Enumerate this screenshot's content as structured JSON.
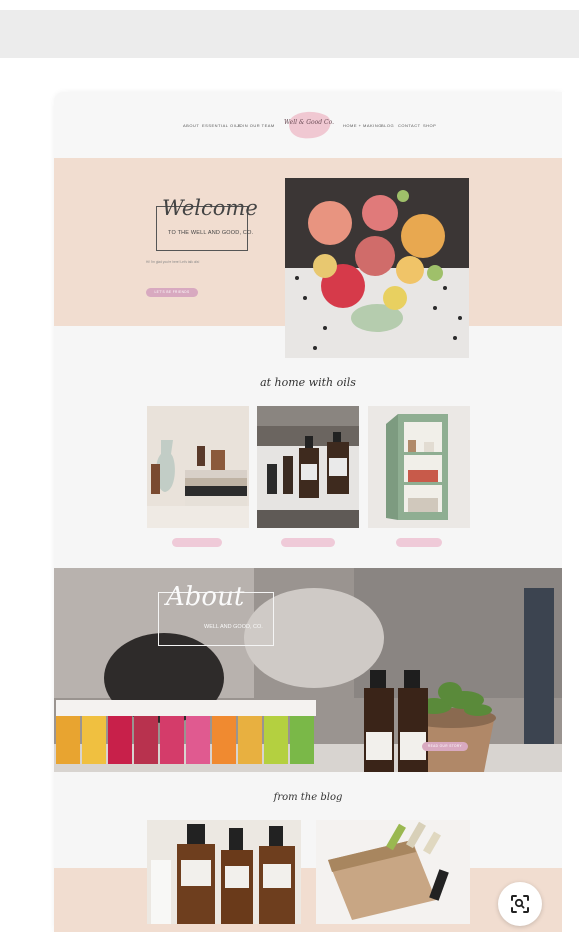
{
  "nav": {
    "items_left": [
      "ABOUT",
      "ESSENTIAL OILS",
      "JOIN OUR TEAM"
    ],
    "items_right": [
      "HOME + MAKING",
      "BLOG",
      "CONTACT",
      "SHOP"
    ],
    "logo_text": "Well & Good Co."
  },
  "hero": {
    "welcome_script": "Welcome",
    "welcome_sub": "TO THE WELL AND GOOD, CO.",
    "body": "Hi! I'm glad you're here! Let's talk oils!",
    "cta_label": "LET'S BE FRIENDS"
  },
  "oils": {
    "title": "at home with oils"
  },
  "about": {
    "script": "About",
    "sub": "WELL AND GOOD, CO.",
    "cta_label": "READ OUR STORY"
  },
  "blog": {
    "title": "from the blog"
  },
  "colors": {
    "blush": "#f1ddd0",
    "pink_accent": "#d8a9c0",
    "pale_pink": "#efcad8",
    "page_gray": "#f6f6f6"
  },
  "icons": {
    "lens": "visual-search-icon"
  }
}
